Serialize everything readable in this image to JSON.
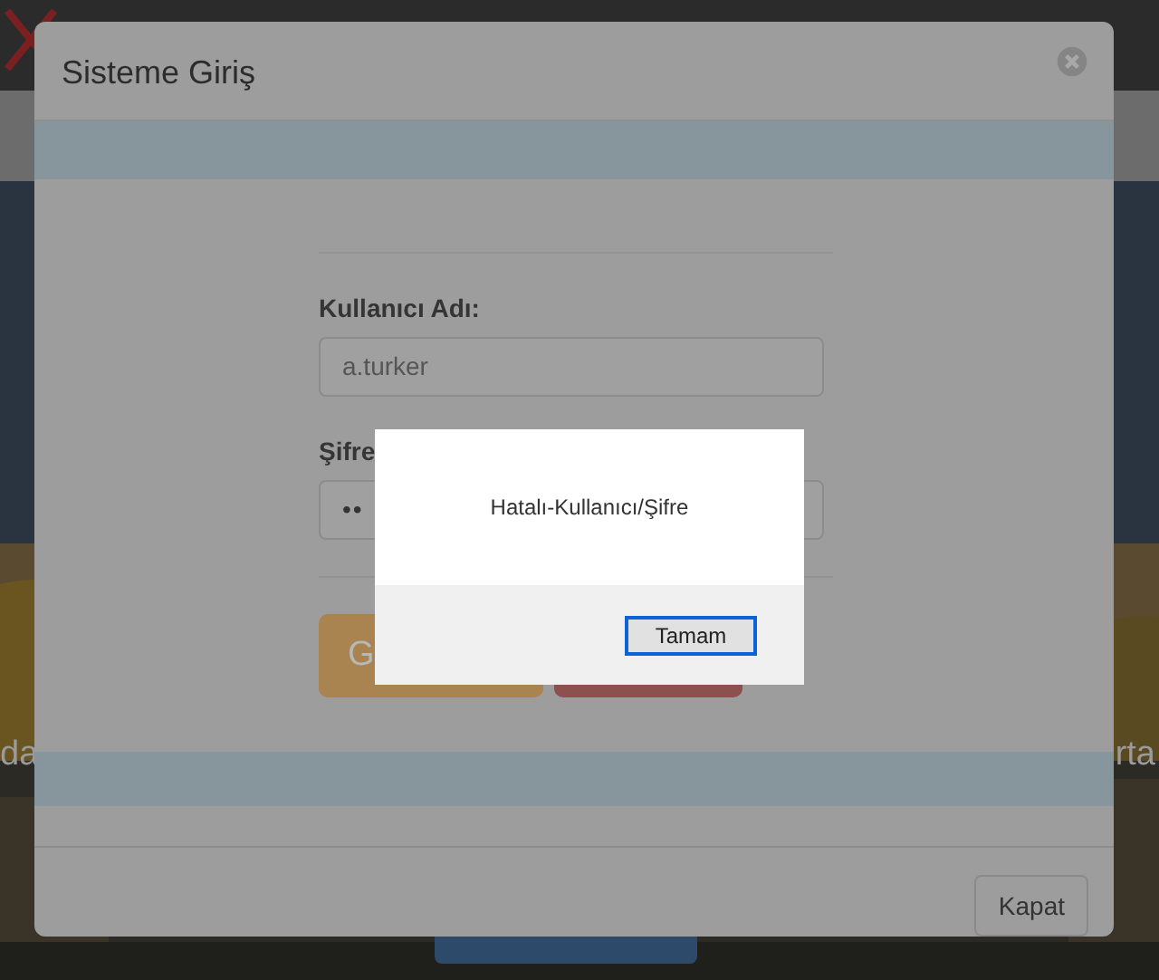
{
  "page": {
    "side_text_left": "da",
    "side_text_right": "rta"
  },
  "modal": {
    "title": "Sisteme Giriş",
    "fields": [
      {
        "label": "Kullanıcı Adı:",
        "value": "a.turker",
        "kind": "text"
      },
      {
        "label": "Şifre",
        "value": "••",
        "kind": "password"
      }
    ],
    "login_button": "G",
    "close_button": "Kapat"
  },
  "alert": {
    "message": "Hatalı-Kullanıcı/Şifre",
    "button": "Tamam"
  }
}
